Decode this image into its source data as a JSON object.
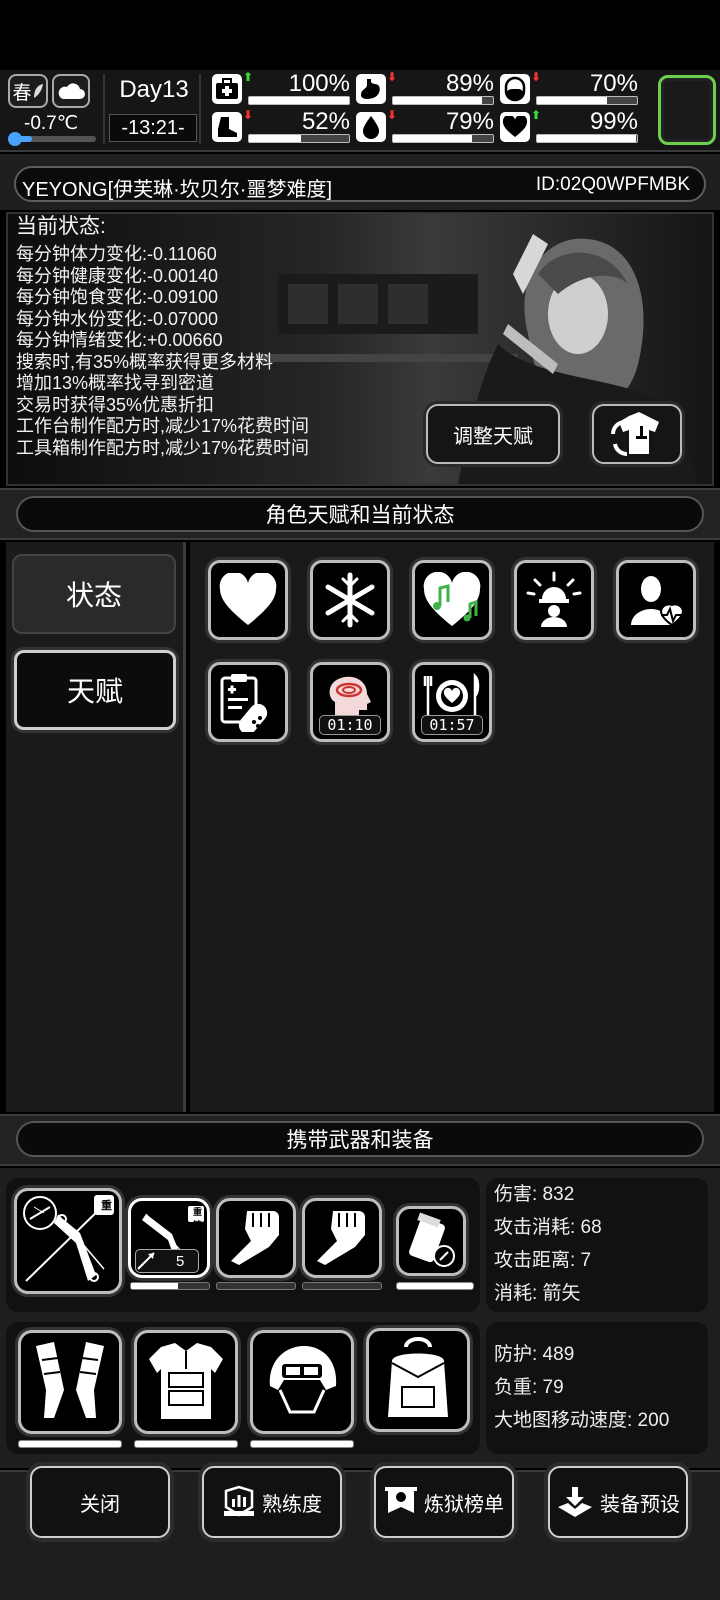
{
  "topbar": {
    "season": "春",
    "temperature": "-0.7℃",
    "day": "Day13",
    "time": "-13:21-",
    "stats": [
      {
        "name": "medical",
        "icon": "medkit-icon",
        "trend": "up",
        "value_text": "100%",
        "value": 1.0
      },
      {
        "name": "stomach",
        "icon": "stomach-icon",
        "trend": "down",
        "value_text": "89%",
        "value": 0.89
      },
      {
        "name": "pill",
        "icon": "pill-icon",
        "trend": "down",
        "value_text": "70%",
        "value": 0.7
      },
      {
        "name": "boot",
        "icon": "boot-icon",
        "trend": "down",
        "value_text": "52%",
        "value": 0.52
      },
      {
        "name": "water",
        "icon": "water-drop-icon",
        "trend": "down",
        "value_text": "79%",
        "value": 0.79
      },
      {
        "name": "mood",
        "icon": "heart-icon",
        "trend": "up",
        "value_text": "99%",
        "value": 0.99
      }
    ]
  },
  "character": {
    "name": "YEYONG[伊芙琳·坎贝尔·噩梦难度]",
    "id": "ID:02Q0WPFMBK",
    "status_title": "当前状态:",
    "status_lines": [
      "每分钟体力变化:-0.11060",
      "每分钟健康变化:-0.00140",
      "每分钟饱食变化:-0.09100",
      "每分钟水份变化:-0.07000",
      "每分钟情绪变化:+0.00660",
      "搜索时,有35%概率获得更多材料",
      "增加13%概率找寻到密道",
      "交易时获得35%优惠折扣",
      "工作台制作配方时,减少17%花费时间",
      "工具箱制作配方时,减少17%花费时间"
    ],
    "adjust_talent_button": "调整天赋"
  },
  "talent_section": {
    "header": "角色天赋和当前状态",
    "tabs": [
      "状态",
      "天赋"
    ],
    "effects": [
      {
        "icon": "heart-icon"
      },
      {
        "icon": "snowflake-icon"
      },
      {
        "icon": "music-heart-icon"
      },
      {
        "icon": "alarm-person-icon"
      },
      {
        "icon": "person-health-icon"
      },
      {
        "icon": "medical-report-pill-icon"
      },
      {
        "icon": "brain-dizzy-icon",
        "timer": "01:10"
      },
      {
        "icon": "meal-plate-icon",
        "timer": "01:57"
      }
    ]
  },
  "equipment_section": {
    "header": "携带武器和装备",
    "weapon_badge": "重铸",
    "ammo_count": "5",
    "weapon_stats": [
      "伤害: 832",
      "攻击消耗: 68",
      "攻击距离: 7",
      "消耗: 箭矢"
    ],
    "armor_stats": [
      "防护: 489",
      "负重: 79",
      "大地图移动速度: 200"
    ]
  },
  "bottom_bar": {
    "close": "关闭",
    "proficiency": "熟练度",
    "ranking": "炼狱榜单",
    "preset": "装备预设"
  }
}
